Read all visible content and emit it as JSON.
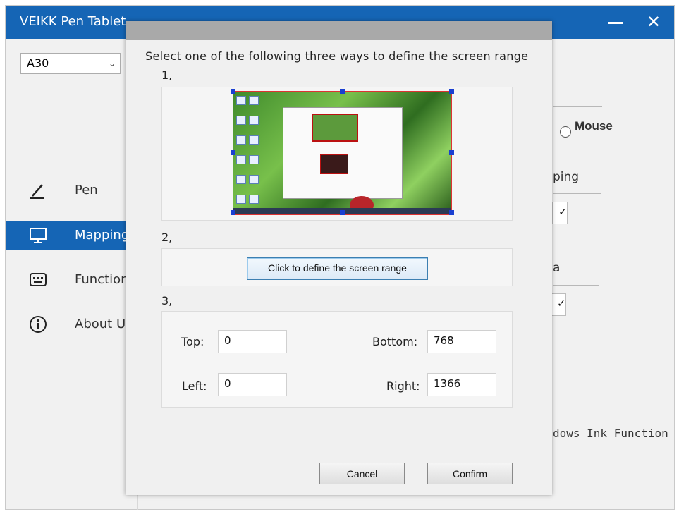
{
  "app": {
    "title": "VEIKK Pen Tablet",
    "minimize_glyph": "—",
    "close_glyph": "✕",
    "device": "A30"
  },
  "sidebar": {
    "items": [
      {
        "label": "Pen",
        "icon": "pen-icon"
      },
      {
        "label": "Mapping",
        "icon": "monitor-icon"
      },
      {
        "label": "Function",
        "icon": "keyboard-icon"
      },
      {
        "label": "About Us",
        "icon": "info-icon"
      }
    ]
  },
  "background": {
    "mouse_label": "Mouse",
    "mapping_fragment": "ping",
    "area_fragment": "a",
    "ink_fragment": "dows Ink Function",
    "check_glyph": "✓"
  },
  "dialog": {
    "heading": "Select one of the following three ways to define the screen range",
    "step1": "1,",
    "step2": "2,",
    "step3": "3,",
    "define_button": "Click to define the screen range",
    "top_label": "Top:",
    "top_value": "0",
    "bottom_label": "Bottom:",
    "bottom_value": "768",
    "left_label": "Left:",
    "left_value": "0",
    "right_label": "Right:",
    "right_value": "1366",
    "cancel": "Cancel",
    "confirm": "Confirm"
  },
  "colors": {
    "accent": "#1565b5",
    "selection_border": "#dd3333",
    "handle": "#1a3fd1"
  }
}
